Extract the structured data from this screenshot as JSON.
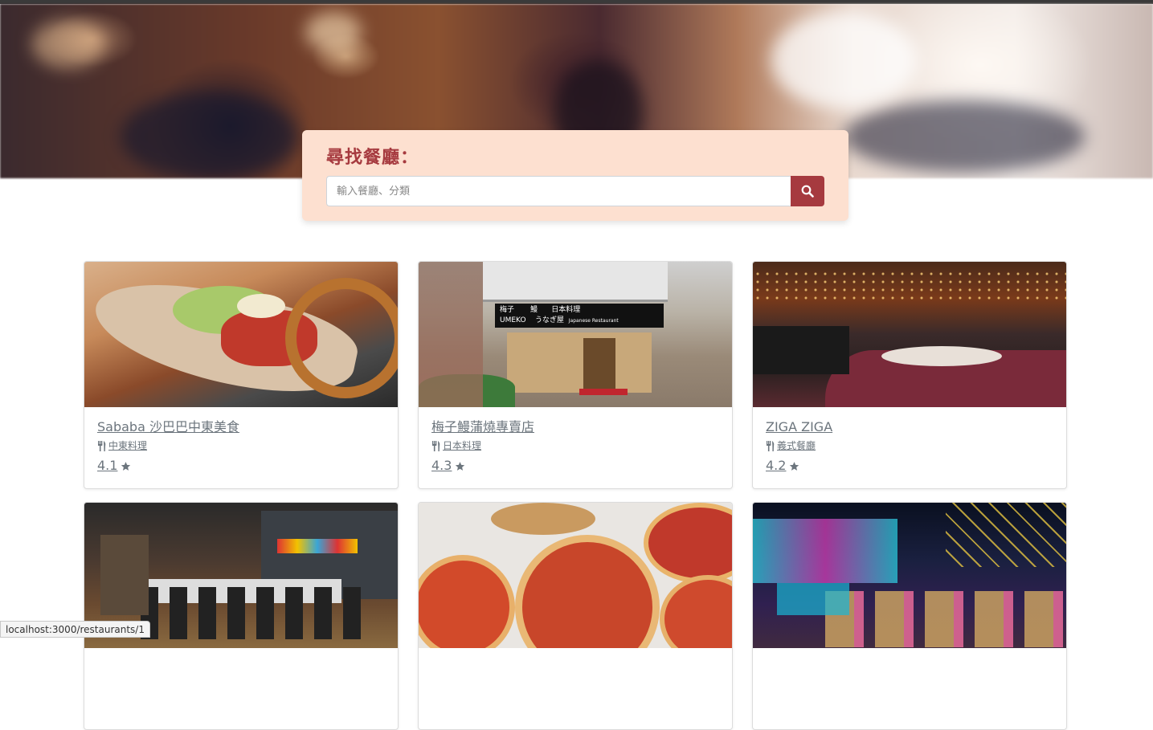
{
  "search": {
    "title": "尋找餐廳：",
    "placeholder": "輸入餐廳、分類",
    "button_icon": "search-icon"
  },
  "restaurants": [
    {
      "name": "Sababa 沙巴巴中東美食",
      "category": "中東料理",
      "rating": "4.1",
      "category_icon": "utensils-icon",
      "rating_icon": "star-icon"
    },
    {
      "name": "梅子鰻蒲燒專賣店",
      "category": "日本料理",
      "rating": "4.3",
      "category_icon": "utensils-icon",
      "rating_icon": "star-icon"
    },
    {
      "name": "ZIGA ZIGA",
      "category": "義式餐廳",
      "rating": "4.2",
      "category_icon": "utensils-icon",
      "rating_icon": "star-icon"
    },
    {
      "name": "",
      "category": "",
      "rating": ""
    },
    {
      "name": "",
      "category": "",
      "rating": ""
    },
    {
      "name": "",
      "category": "",
      "rating": ""
    }
  ],
  "storefront_sign": {
    "name": "梅子",
    "eel": "鰻",
    "english": "UMEKO",
    "kana": "うなぎ屋",
    "type": "日本料理",
    "type_en": "Japanese Restaurant"
  },
  "status_bar": {
    "url": "localhost:3000/restaurants/1"
  },
  "colors": {
    "accent": "#a63a3f",
    "search_panel": "#fde0d0",
    "text_muted": "#6c757d"
  }
}
